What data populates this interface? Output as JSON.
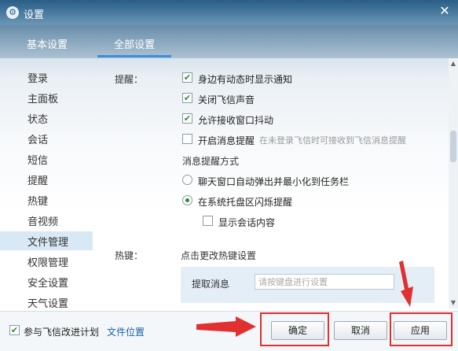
{
  "window": {
    "title": "设置",
    "icon": "gear-icon",
    "close_icon": "close-icon"
  },
  "tabs": [
    {
      "label": "基本设置",
      "active": false
    },
    {
      "label": "全部设置",
      "active": true
    }
  ],
  "sidebar": {
    "items": [
      {
        "label": "登录"
      },
      {
        "label": "主面板"
      },
      {
        "label": "状态"
      },
      {
        "label": "会话"
      },
      {
        "label": "短信"
      },
      {
        "label": "提醒",
        "active": true
      },
      {
        "label": "热键"
      },
      {
        "label": "音视频"
      },
      {
        "label": "文件管理"
      },
      {
        "label": "权限管理"
      },
      {
        "label": "安全设置"
      },
      {
        "label": "天气设置"
      }
    ]
  },
  "reminder": {
    "section_label": "提醒：",
    "options": [
      {
        "label": "身边有动态时显示通知",
        "checked": true
      },
      {
        "label": "关闭飞信声音",
        "checked": true
      },
      {
        "label": "允许接收窗口抖动",
        "checked": true
      },
      {
        "label": "开启消息提醒",
        "hint": "在未登录飞信时可接收到飞信消息提醒",
        "checked": false
      }
    ],
    "mode_label": "消息提醒方式",
    "modes": [
      {
        "label": "聊天窗口自动弹出并最小化到任务栏",
        "selected": false
      },
      {
        "label": "在系统托盘区闪烁提醒",
        "selected": true
      }
    ],
    "show_content": {
      "label": "显示会话内容",
      "checked": false
    }
  },
  "hotkey": {
    "section_label": "热键：",
    "hint": "点击更改热键设置",
    "fetch_label": "提取消息",
    "fetch_placeholder": "请按键盘进行设置"
  },
  "footer": {
    "join_label": "参与飞信改进计划",
    "join_checked": true,
    "file_location": "文件位置",
    "ok": "确定",
    "cancel": "取消",
    "apply": "应用"
  },
  "colors": {
    "accent": "#3b8ee0",
    "check": "#2a8d2a",
    "annotation": "#e03030"
  }
}
